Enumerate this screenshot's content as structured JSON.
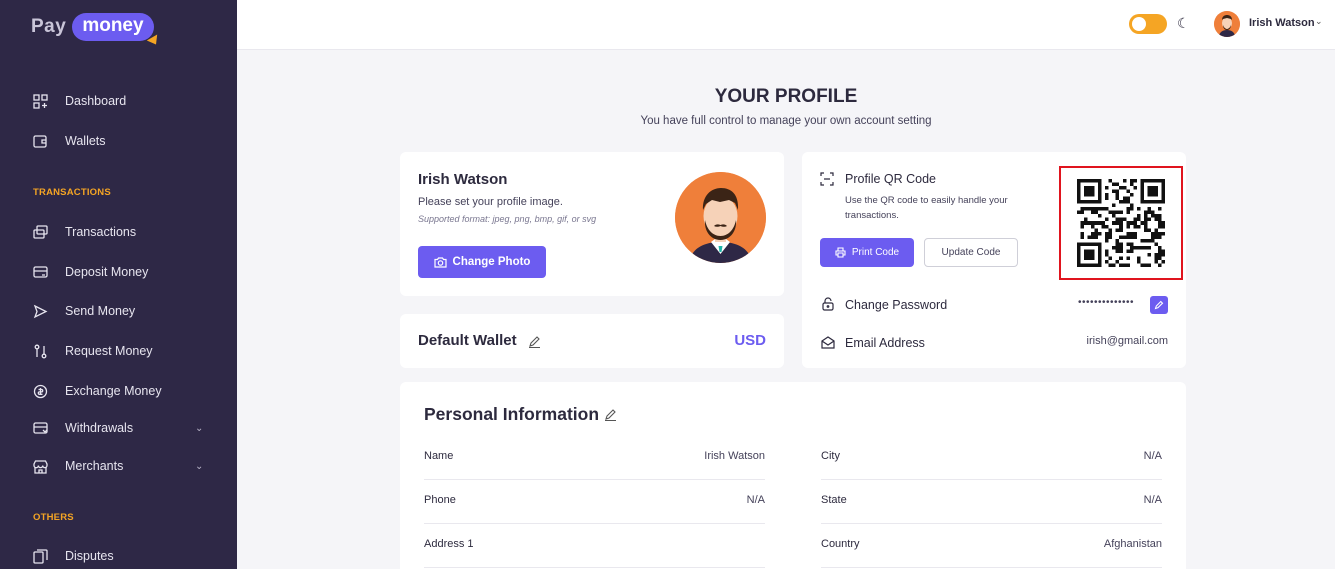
{
  "brand": {
    "pay": "Pay",
    "money": "money"
  },
  "sidebar": {
    "items_top": [
      {
        "label": "Dashboard",
        "icon": "dashboard-icon"
      },
      {
        "label": "Wallets",
        "icon": "wallet-icon"
      }
    ],
    "section_transactions": "TRANSACTIONS",
    "items_transactions": [
      {
        "label": "Transactions",
        "icon": "transactions-icon"
      },
      {
        "label": "Deposit Money",
        "icon": "deposit-icon"
      },
      {
        "label": "Send Money",
        "icon": "send-icon"
      },
      {
        "label": "Request Money",
        "icon": "request-icon"
      },
      {
        "label": "Exchange Money",
        "icon": "exchange-icon"
      },
      {
        "label": "Withdrawals",
        "icon": "withdrawals-icon"
      },
      {
        "label": "Merchants",
        "icon": "merchants-icon"
      }
    ],
    "section_others": "OTHERS",
    "items_others": [
      {
        "label": "Disputes",
        "icon": "disputes-icon"
      }
    ]
  },
  "header": {
    "user_name": "Irish Watson",
    "theme_toggle": "light-mode",
    "accent": "#f5a524"
  },
  "page": {
    "title": "YOUR PROFILE",
    "subtitle": "You have full control to manage your own account setting"
  },
  "profile_card": {
    "name": "Irish Watson",
    "hint": "Please set your profile image.",
    "formats": "Supported format: jpeg, png, bmp, gif, or svg",
    "change_photo": "Change Photo"
  },
  "wallet_card": {
    "label": "Default Wallet",
    "currency": "USD"
  },
  "qr_card": {
    "title": "Profile QR Code",
    "description": "Use the QR code to easily handle your transactions.",
    "print_label": "Print Code",
    "update_label": "Update Code",
    "password_label": "Change Password",
    "password_mask": "••••••••••••••",
    "email_label": "Email Address",
    "email_value": "irish@gmail.com"
  },
  "personal": {
    "title": "Personal Information",
    "left": [
      {
        "key": "Name",
        "value": "Irish Watson"
      },
      {
        "key": "Phone",
        "value": "N/A"
      },
      {
        "key": "Address 1",
        "value": ""
      }
    ],
    "right": [
      {
        "key": "City",
        "value": "N/A"
      },
      {
        "key": "State",
        "value": "N/A"
      },
      {
        "key": "Country",
        "value": "Afghanistan"
      }
    ]
  },
  "colors": {
    "sidebar": "#2e2846",
    "primary": "#6c5cf0",
    "section": "#f5a524",
    "highlight": "#e0141e"
  }
}
